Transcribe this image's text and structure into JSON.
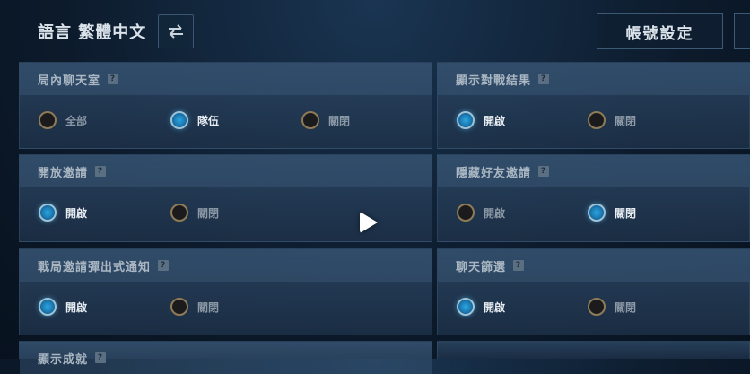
{
  "header": {
    "language_label": "語言 繁體中文",
    "account_button": "帳號設定"
  },
  "panels": [
    {
      "title": "局內聊天室",
      "help": "?",
      "options": [
        "全部",
        "隊伍",
        "關閉"
      ],
      "selected": 1
    },
    {
      "title": "顯示對戰結果",
      "help": "?",
      "options": [
        "開啟",
        "關閉"
      ],
      "selected": 0
    },
    {
      "title": "開放邀請",
      "help": "?",
      "options": [
        "開啟",
        "關閉"
      ],
      "selected": 0
    },
    {
      "title": "隱藏好友邀請",
      "help": "?",
      "options": [
        "開啟",
        "關閉"
      ],
      "selected": 1
    },
    {
      "title": "戰局邀請彈出式通知",
      "help": "?",
      "options": [
        "開啟",
        "關閉"
      ],
      "selected": 0
    },
    {
      "title": "聊天篩選",
      "help": "?",
      "options": [
        "開啟",
        "關閉"
      ],
      "selected": 0
    },
    {
      "title": "顯示成就",
      "help": "?",
      "options": [],
      "selected": -1
    }
  ],
  "colors": {
    "radio_selected": "#2ea6dc",
    "radio_unselected_ring": "#8f7b56",
    "panel_bg": "#2c4663"
  },
  "icons": {
    "swap": "swap-arrows-icon",
    "video_overlay": "play-icon"
  }
}
